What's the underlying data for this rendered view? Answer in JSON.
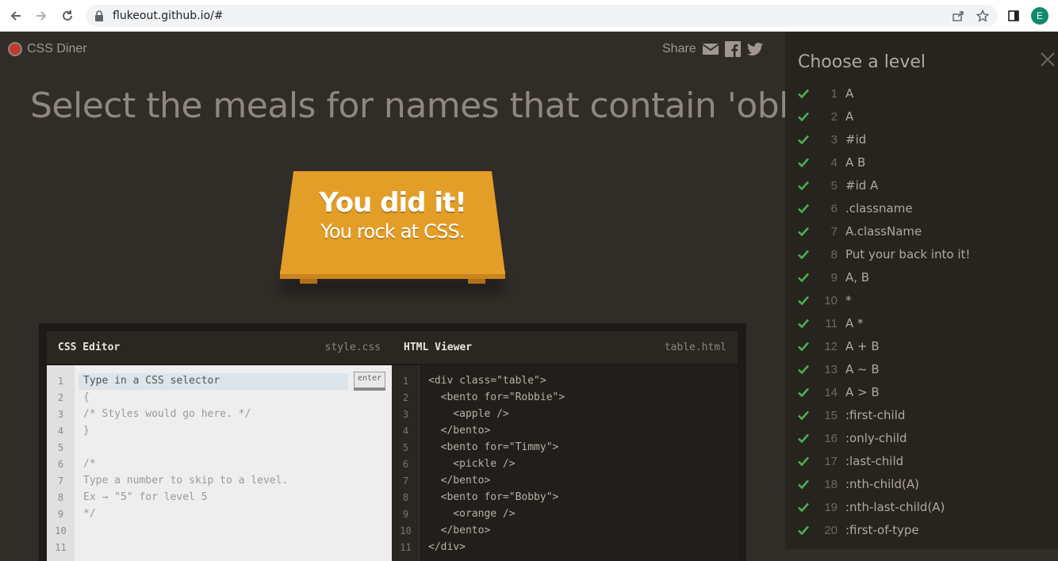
{
  "browser": {
    "url": "flukeout.github.io/#",
    "profile_initial": "E",
    "icons": [
      "back-icon",
      "forward-icon",
      "reload-icon",
      "lock-icon",
      "share-icon",
      "star-icon",
      "sidebar-icon"
    ]
  },
  "app": {
    "logo_text": "CSS Diner",
    "share_label": "Share",
    "share_icons": [
      "email-icon",
      "facebook-icon",
      "twitter-icon"
    ]
  },
  "level_instruction": "Select the meals for names that contain 'obb'",
  "success": {
    "line1": "You did it!",
    "line2": "You rock at CSS."
  },
  "css_editor": {
    "title": "CSS Editor",
    "filename": "style.css",
    "input_placeholder": "Type in a CSS selector",
    "enter_label": "enter",
    "line_numbers": [
      "1",
      "2",
      "3",
      "4",
      "5",
      "6",
      "7",
      "8",
      "9",
      "10",
      "11"
    ],
    "lines": [
      "{",
      "/* Styles would go here. */",
      "}",
      "",
      "/*",
      "Type a number to skip to a level.",
      "Ex → \"5\" for level 5",
      "*/",
      "",
      ""
    ]
  },
  "html_viewer": {
    "title": "HTML Viewer",
    "filename": "table.html",
    "line_numbers": [
      "1",
      "2",
      "3",
      "4",
      "5",
      "6",
      "7",
      "8",
      "9",
      "10",
      "11"
    ],
    "lines": [
      "<div class=\"table\">",
      "  <bento for=\"Robbie\">",
      "    <apple />",
      "  </bento>",
      "  <bento for=\"Timmy\">",
      "    <pickle />",
      "  </bento>",
      "  <bento for=\"Bobby\">",
      "    <orange />",
      "  </bento>",
      "</div>"
    ]
  },
  "sidebar": {
    "title": "Choose a level",
    "levels": [
      {
        "num": "1",
        "name": "A"
      },
      {
        "num": "2",
        "name": "A"
      },
      {
        "num": "3",
        "name": "#id"
      },
      {
        "num": "4",
        "name": "A  B"
      },
      {
        "num": "5",
        "name": "#id  A"
      },
      {
        "num": "6",
        "name": ".classname"
      },
      {
        "num": "7",
        "name": "A.className"
      },
      {
        "num": "8",
        "name": "Put your back into it!"
      },
      {
        "num": "9",
        "name": "A, B"
      },
      {
        "num": "10",
        "name": "*"
      },
      {
        "num": "11",
        "name": "A  *"
      },
      {
        "num": "12",
        "name": "A + B"
      },
      {
        "num": "13",
        "name": "A ~ B"
      },
      {
        "num": "14",
        "name": "A > B"
      },
      {
        "num": "15",
        "name": ":first-child"
      },
      {
        "num": "16",
        "name": ":only-child"
      },
      {
        "num": "17",
        "name": ":last-child"
      },
      {
        "num": "18",
        "name": ":nth-child(A)"
      },
      {
        "num": "19",
        "name": ":nth-last-child(A)"
      },
      {
        "num": "20",
        "name": ":first-of-type"
      }
    ]
  },
  "colors": {
    "check": "#4cae4c",
    "table": "#e39e28"
  }
}
